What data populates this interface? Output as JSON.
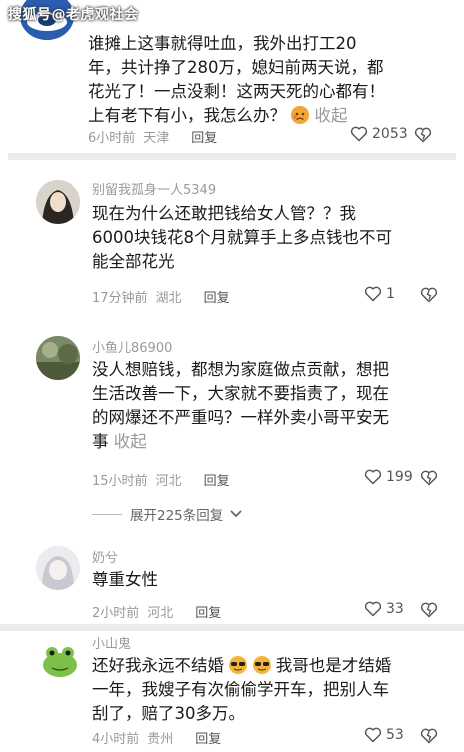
{
  "watermark": "搜狐号@老虎观社会",
  "comments": [
    {
      "text_lines": [
        "谁摊上这事就得吐血，我外出打工20",
        "年，共计挣了280万，媳妇前两天说，都",
        "花光了！一点没剩！这两天死的心都有！",
        "上有老下有小，我怎么办？"
      ],
      "collapse": "收起",
      "time": "6小时前",
      "location": "天津",
      "reply": "回复",
      "likes": "2053"
    },
    {
      "username": "别留我孤身一人5349",
      "text_lines": [
        "现在为什么还敢把钱给女人管？？我",
        "6000块钱花8个月就算手上多点钱也不可",
        "能全部花光"
      ],
      "time": "17分钟前",
      "location": "湖北",
      "reply": "回复",
      "likes": "1"
    },
    {
      "username": "小鱼儿86900",
      "text_lines": [
        "没人想赔钱，都想为家庭做点贡献，想把",
        "生活改善一下，大家就不要指责了，现在",
        "的网爆还不严重吗？一样外卖小哥平安无",
        "事"
      ],
      "collapse": "收起",
      "time": "15小时前",
      "location": "河北",
      "reply": "回复",
      "likes": "199",
      "expand": "展开225条回复"
    },
    {
      "username": "奶兮",
      "text_lines": [
        "尊重女性"
      ],
      "time": "2小时前",
      "location": "河北",
      "reply": "回复",
      "likes": "33"
    },
    {
      "username": "小山鬼",
      "text_lines": [
        "还好我永远不结婚",
        "一年，我嫂子有次偷偷学开车，把别人车",
        "刮了，赔了30多万。"
      ],
      "text_line0_tail": "我哥也是才结婚",
      "time": "4小时前",
      "location": "贵州",
      "reply": "回复",
      "likes": "53"
    }
  ],
  "colors": {
    "meta": "#9a9a9a",
    "text": "#1a1a1a",
    "divider": "#ececec"
  },
  "icons": [
    "heart-outline-icon",
    "broken-heart-icon",
    "chevron-down-icon",
    "sad-face-emoji",
    "sunglasses-emoji"
  ]
}
